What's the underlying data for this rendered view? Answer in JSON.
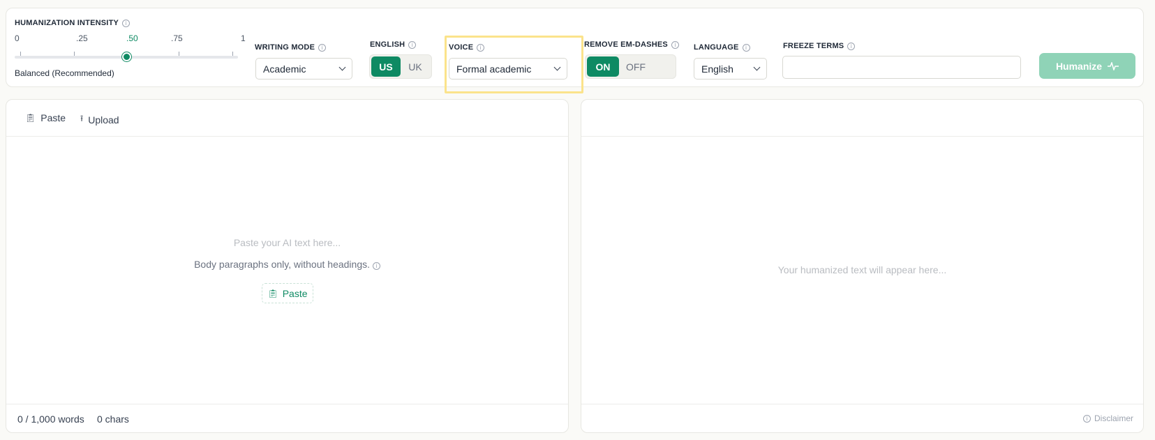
{
  "intensity": {
    "label": "HUMANIZATION INTENSITY",
    "ticks": [
      "0",
      ".25",
      ".50",
      ".75",
      "1"
    ],
    "value": 0.5,
    "note": "Balanced (Recommended)"
  },
  "writing_mode": {
    "label": "WRITING MODE",
    "value": "Academic"
  },
  "english": {
    "label": "ENGLISH",
    "options": [
      "US",
      "UK"
    ],
    "selected": "US"
  },
  "voice": {
    "label": "VOICE",
    "value": "Formal academic"
  },
  "em_dashes": {
    "label": "REMOVE EM-DASHES",
    "options": [
      "ON",
      "OFF"
    ],
    "selected": "ON"
  },
  "language": {
    "label": "LANGUAGE",
    "value": "English"
  },
  "freeze_terms": {
    "label": "FREEZE TERMS",
    "value": ""
  },
  "humanize_button": "Humanize",
  "input_panel": {
    "paste_label": "Paste",
    "upload_label": "Upload",
    "placeholder": "Paste your AI text here...",
    "hint": "Body paragraphs only, without headings.",
    "paste_chip": "Paste",
    "word_count": "0 / 1,000 words",
    "char_count": "0 chars"
  },
  "output_panel": {
    "placeholder": "Your humanized text will appear here...",
    "disclaimer": "Disclaimer"
  },
  "colors": {
    "accent": "#0e8a63",
    "accent_light": "#8fd3b7",
    "highlight": "#fbe38b"
  }
}
